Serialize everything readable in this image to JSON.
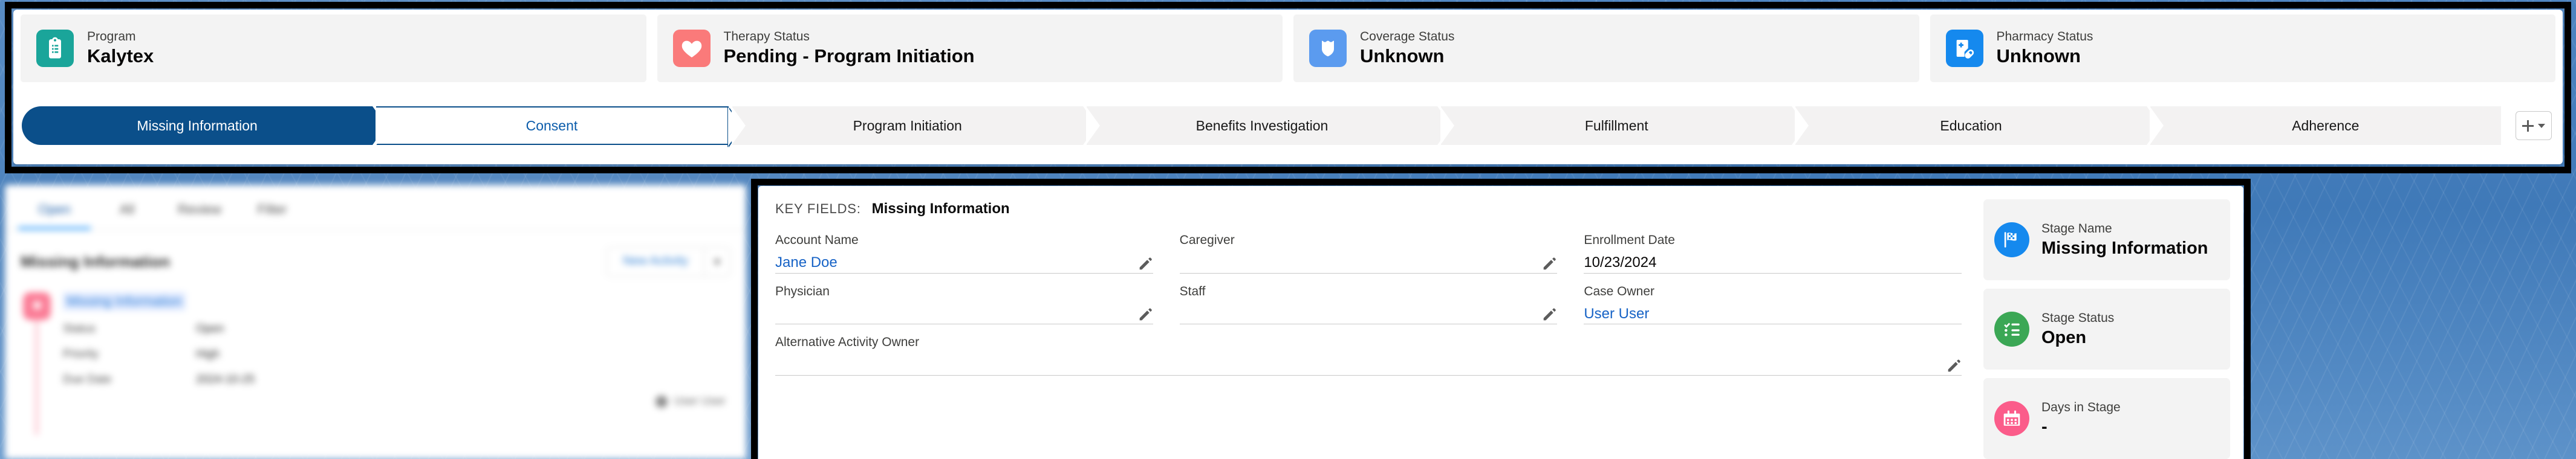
{
  "highlights": [
    {
      "label": "Program",
      "value": "Kalytex",
      "icon": "clipboard-list-icon",
      "color": "#1aa59a"
    },
    {
      "label": "Therapy Status",
      "value": "Pending - Program Initiation",
      "icon": "heart-icon",
      "color": "#fa7a7a"
    },
    {
      "label": "Coverage Status",
      "value": "Unknown",
      "icon": "shield-icon",
      "color": "#5b9bef"
    },
    {
      "label": "Pharmacy Status",
      "value": "Unknown",
      "icon": "prescription-pill-icon",
      "color": "#1589ee"
    }
  ],
  "path": {
    "stages": [
      {
        "label": "Missing Information",
        "state": "done"
      },
      {
        "label": "Consent",
        "state": "current"
      },
      {
        "label": "Program Initiation",
        "state": "upcoming"
      },
      {
        "label": "Benefits Investigation",
        "state": "upcoming"
      },
      {
        "label": "Fulfillment",
        "state": "upcoming"
      },
      {
        "label": "Education",
        "state": "upcoming"
      },
      {
        "label": "Adherence",
        "state": "upcoming"
      }
    ],
    "add_button_label": "+",
    "add_button_caret": "▾"
  },
  "key_fields": {
    "heading_label": "KEY FIELDS:",
    "heading_value": "Missing Information",
    "fields": [
      {
        "label": "Account Name",
        "value": "Jane Doe",
        "link": true,
        "editable": true
      },
      {
        "label": "Caregiver",
        "value": "",
        "link": false,
        "editable": true
      },
      {
        "label": "Enrollment Date",
        "value": "10/23/2024",
        "link": false,
        "editable": false
      },
      {
        "label": "Physician",
        "value": "",
        "link": false,
        "editable": true
      },
      {
        "label": "Staff",
        "value": "",
        "link": false,
        "editable": true
      },
      {
        "label": "Case Owner",
        "value": "User User",
        "link": true,
        "editable": false
      },
      {
        "label": "Alternative Activity Owner",
        "value": "",
        "link": false,
        "editable": true,
        "wide": true
      }
    ]
  },
  "stage_rail": [
    {
      "label": "Stage Name",
      "value": "Missing Information",
      "icon": "checkered-flag-icon",
      "color": "#1589ee"
    },
    {
      "label": "Stage Status",
      "value": "Open",
      "icon": "checklist-icon",
      "color": "#3ba755"
    },
    {
      "label": "Days in Stage",
      "value": "-",
      "icon": "calendar-icon",
      "color": "#fb5c8a"
    }
  ],
  "left_panel": {
    "tabs": [
      {
        "label": "Open",
        "selected": true
      },
      {
        "label": "All",
        "selected": false
      },
      {
        "label": "Review",
        "selected": false
      },
      {
        "label": "Filter",
        "selected": false
      }
    ],
    "title": "Missing Information",
    "new_button_label": "New Activity",
    "new_button_caret": "▾",
    "item_link": "Missing Information",
    "meta": [
      {
        "key": "Status",
        "value": "Open"
      },
      {
        "key": "Priority",
        "value": "High"
      },
      {
        "key": "Due Date",
        "value": "2024-10-25"
      }
    ],
    "owner": "User User"
  }
}
